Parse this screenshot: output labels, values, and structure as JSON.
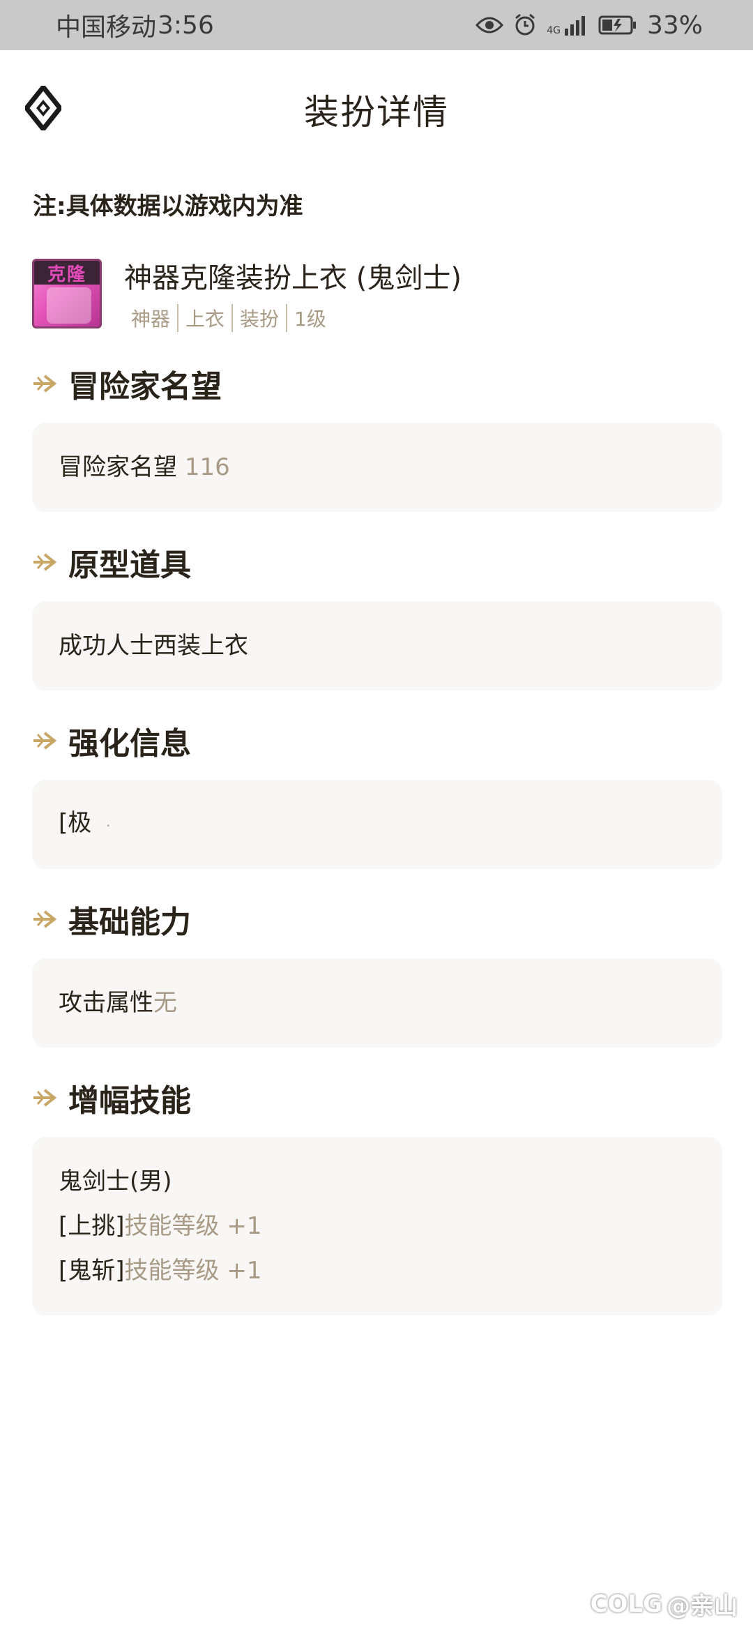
{
  "status_bar": {
    "carrier": "中国移动",
    "time": "3:56",
    "network": "4G",
    "battery": "33%"
  },
  "header": {
    "title": "装扮详情"
  },
  "note": "注:具体数据以游戏内为准",
  "item": {
    "icon_text": "克隆",
    "name": "神器克隆装扮上衣 (鬼剑士)",
    "tags": [
      "神器",
      "上衣",
      "装扮",
      "1级"
    ]
  },
  "sections": {
    "reputation": {
      "title": "冒险家名望",
      "label": "冒险家名望",
      "value": "116"
    },
    "prototype": {
      "title": "原型道具",
      "value": "成功人士西装上衣"
    },
    "enhance": {
      "title": "强化信息",
      "value": "[极",
      "dot": "·"
    },
    "base": {
      "title": "基础能力",
      "label": "攻击属性",
      "value": "无"
    },
    "skills": {
      "title": "增幅技能",
      "class_name": "鬼剑士(男)",
      "lines": [
        {
          "skill": "[上挑]",
          "effect": "技能等级 +1"
        },
        {
          "skill": "[鬼斩]",
          "effect": "技能等级 +1"
        }
      ]
    }
  },
  "watermark": {
    "brand": "COLG",
    "user": "@亲山"
  },
  "colors": {
    "accent": "#c9a765",
    "muted_text": "#a89a84",
    "card_bg": "#f8f7f5",
    "status_bar_bg": "#c9c9c9"
  }
}
